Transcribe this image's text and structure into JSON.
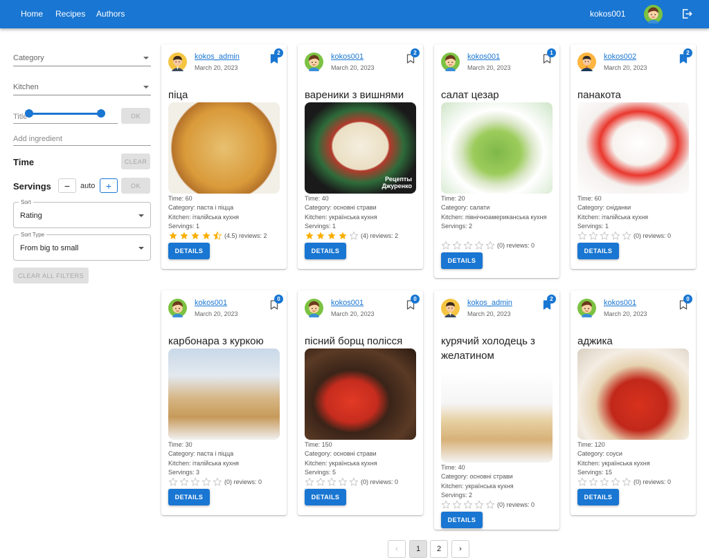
{
  "nav": {
    "home": "Home",
    "recipes": "Recipes",
    "authors": "Authors",
    "user": "kokos001"
  },
  "filters": {
    "category": "Category",
    "kitchen": "Kitchen",
    "title_placeholder": "Title",
    "ok": "OK",
    "ingredient_placeholder": "Add ingredient",
    "time_label": "Time",
    "clear": "CLEAR",
    "servings_label": "Servings",
    "servings_value": "auto",
    "minus": "−",
    "plus": "+",
    "sort_legend": "Sort",
    "sort_value": "Rating",
    "sort_type_legend": "Sort Type",
    "sort_type_value": "From big to small",
    "clear_all": "CLEAR ALL FILTERS"
  },
  "cards": [
    {
      "author": "kokos_admin",
      "avatar": "admin",
      "date": "March 20, 2023",
      "bookmarked": true,
      "badge": "2",
      "title": "піца",
      "time": "Time: 60",
      "category": "Category: паста і піцца",
      "kitchen": "Kitchen: італійська кухня",
      "servings": "Servings: 1",
      "rating": 4.5,
      "rating_text": "(4.5) reviews: 2",
      "details": "DETAILS",
      "photo": "pizza-photo"
    },
    {
      "author": "kokos001",
      "avatar": "boy",
      "date": "March 20, 2023",
      "bookmarked": false,
      "badge": "2",
      "title": "вареники з вишнями",
      "time": "Time: 40",
      "category": "Category: основні страви",
      "kitchen": "Kitchen: українська кухня",
      "servings": "Servings: 1",
      "rating": 4,
      "rating_text": "(4) reviews: 2",
      "details": "DETAILS",
      "photo": "vareniki-photo",
      "watermark": "Рецепты Джуренко"
    },
    {
      "author": "kokos001",
      "avatar": "boy",
      "date": "March 20, 2023",
      "bookmarked": false,
      "badge": "1",
      "title": "салат цезар",
      "time": "Time: 20",
      "category": "Category: салати",
      "kitchen": "Kitchen: північноамериканська кухня",
      "servings": "Servings: 2",
      "rating": 0,
      "rating_text": "(0) reviews: 0",
      "details": "DETAILS",
      "photo": "salad-photo"
    },
    {
      "author": "kokos002",
      "avatar": "man",
      "date": "March 20, 2023",
      "bookmarked": true,
      "badge": "2",
      "title": "панакота",
      "time": "Time: 60",
      "category": "Category: сніданки",
      "kitchen": "Kitchen: італійська кухня",
      "servings": "Servings: 1",
      "rating": 0,
      "rating_text": "(0) reviews: 0",
      "details": "DETAILS",
      "photo": "panna-cotta-photo"
    },
    {
      "author": "kokos001",
      "avatar": "boy",
      "date": "March 20, 2023",
      "bookmarked": false,
      "badge": "0",
      "title": "карбонара з куркою",
      "time": "Time: 30",
      "category": "Category: паста і піцца",
      "kitchen": "Kitchen: італійська кухня",
      "servings": "Servings: 3",
      "rating": 0,
      "rating_text": "(0) reviews: 0",
      "details": "DETAILS",
      "photo": "carbonara-photo"
    },
    {
      "author": "kokos001",
      "avatar": "boy",
      "date": "March 20, 2023",
      "bookmarked": false,
      "badge": "0",
      "title": "пісний борщ полісся",
      "time": "Time: 150",
      "category": "Category: основні страви",
      "kitchen": "Kitchen: українська кухня",
      "servings": "Servings: 5",
      "rating": 0,
      "rating_text": "(0) reviews: 0",
      "details": "DETAILS",
      "photo": "borscht-photo"
    },
    {
      "author": "kokos_admin",
      "avatar": "admin",
      "date": "March 20, 2023",
      "bookmarked": true,
      "badge": "2",
      "title": "курячий холодець з желатином",
      "time": "Time: 40",
      "category": "Category: основні страви",
      "kitchen": "Kitchen: українська кухня",
      "servings": "Servings: 2",
      "rating": 0,
      "rating_text": "(0) reviews: 0",
      "details": "DETAILS",
      "photo": "aspic-photo"
    },
    {
      "author": "kokos001",
      "avatar": "boy",
      "date": "March 20, 2023",
      "bookmarked": false,
      "badge": "0",
      "title": "аджика",
      "time": "Time: 120",
      "category": "Category: соуси",
      "kitchen": "Kitchen: українська кухня",
      "servings": "Servings: 15",
      "rating": 0,
      "rating_text": "(0) reviews: 0",
      "details": "DETAILS",
      "photo": "adjika-photo"
    }
  ],
  "pagination": {
    "prev": "‹",
    "pages": [
      "1",
      "2"
    ],
    "next": "›",
    "current": "1"
  },
  "colors": {
    "primary": "#1976d2",
    "star": "#faaf00"
  }
}
